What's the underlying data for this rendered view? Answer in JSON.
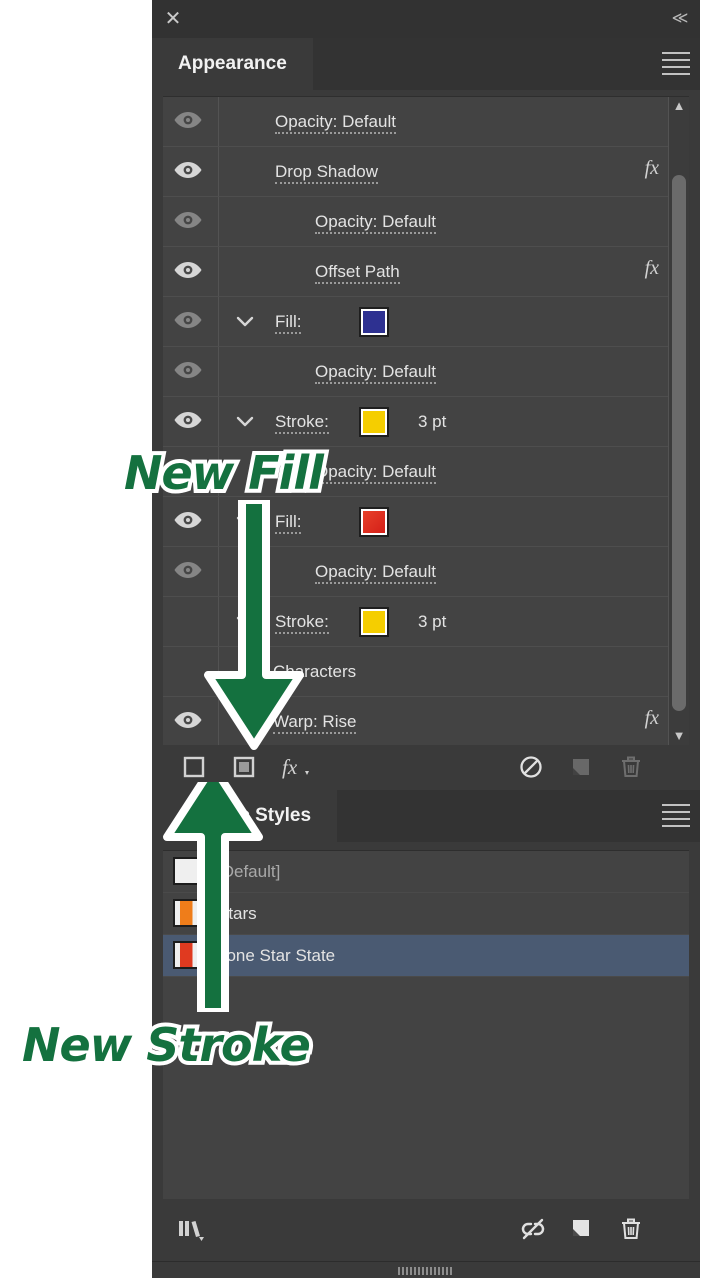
{
  "window": {
    "close_icon": "close-icon",
    "collapse_icon": "collapse-panel-icon"
  },
  "appearance_panel": {
    "tab_label": "Appearance",
    "menu_icon": "panel-menu-icon",
    "rows": [
      {
        "label": "Warp: Rise",
        "eye": "on",
        "twisty": false,
        "indent": 110,
        "fx": true,
        "swatch": null,
        "value": null,
        "type": "effect"
      },
      {
        "label": "Characters",
        "eye": "none",
        "twisty": false,
        "indent": 110,
        "fx": false,
        "swatch": null,
        "value": null,
        "type": "group"
      },
      {
        "label": "Stroke:",
        "eye": "none",
        "twisty": true,
        "indent": 112,
        "fx": false,
        "swatch": "#F5CE00",
        "value": "3 pt",
        "type": "stroke"
      },
      {
        "label": "Opacity: Default",
        "eye": "dim",
        "twisty": false,
        "indent": 152,
        "fx": false,
        "swatch": null,
        "value": null,
        "type": "opacity"
      },
      {
        "label": "Fill:",
        "eye": "on",
        "twisty": true,
        "indent": 112,
        "fx": false,
        "swatch": "#DA2B1E",
        "value": null,
        "type": "fill"
      },
      {
        "label": "Opacity: Default",
        "eye": "dim",
        "twisty": false,
        "indent": 152,
        "fx": false,
        "swatch": null,
        "value": null,
        "type": "opacity"
      },
      {
        "label": "Stroke:",
        "eye": "on",
        "twisty": true,
        "indent": 112,
        "fx": false,
        "swatch": "#F5CE00",
        "value": "3 pt",
        "type": "stroke"
      },
      {
        "label": "Opacity: Default",
        "eye": "dim",
        "twisty": false,
        "indent": 152,
        "fx": false,
        "swatch": null,
        "value": null,
        "type": "opacity"
      },
      {
        "label": "Fill:",
        "eye": "dim",
        "twisty": true,
        "indent": 112,
        "fx": false,
        "swatch": "#2E3191",
        "value": null,
        "type": "fill"
      },
      {
        "label": "Offset Path",
        "eye": "on",
        "twisty": false,
        "indent": 152,
        "fx": true,
        "swatch": null,
        "value": null,
        "type": "effect"
      },
      {
        "label": "Opacity: Default",
        "eye": "dim",
        "twisty": false,
        "indent": 152,
        "fx": false,
        "swatch": null,
        "value": null,
        "type": "opacity"
      },
      {
        "label": "Drop Shadow",
        "eye": "on",
        "twisty": false,
        "indent": 112,
        "fx": true,
        "swatch": null,
        "value": null,
        "type": "effect"
      },
      {
        "label": "Opacity: Default",
        "eye": "dim",
        "twisty": false,
        "indent": 112,
        "fx": false,
        "swatch": null,
        "value": null,
        "type": "opacity"
      }
    ],
    "scrollbar": {
      "up_icon": "chevron-up-icon",
      "down_icon": "chevron-down-icon"
    },
    "toolbar": [
      {
        "name": "add-new-stroke-button",
        "icon": "new-stroke-icon",
        "enabled": true
      },
      {
        "name": "add-new-fill-button",
        "icon": "new-fill-icon",
        "enabled": true
      },
      {
        "name": "add-new-effect-button",
        "icon": "fx-icon",
        "enabled": true
      },
      {
        "name": "clear-appearance-button",
        "icon": "clear-appearance-icon",
        "enabled": true
      },
      {
        "name": "duplicate-item-button",
        "icon": "duplicate-icon",
        "enabled": false
      },
      {
        "name": "delete-item-button",
        "icon": "trash-icon",
        "enabled": false
      }
    ]
  },
  "styles_panel": {
    "tab_label": "Graphic Styles",
    "menu_icon": "panel-menu-icon",
    "items": [
      {
        "label": "[Default]",
        "selected": false,
        "thumb": "#efefef",
        "muted": true
      },
      {
        "label": "Stars",
        "selected": false,
        "thumb": "#ef7d1a",
        "muted": false
      },
      {
        "label": "Lone Star State",
        "selected": true,
        "thumb": "#e03a20",
        "muted": false
      }
    ],
    "toolbar": [
      {
        "name": "styles-libraries-button",
        "icon": "library-icon",
        "enabled": true
      },
      {
        "name": "break-link-to-style-button",
        "icon": "break-link-icon",
        "enabled": true
      },
      {
        "name": "new-style-button",
        "icon": "new-document-icon",
        "enabled": true
      },
      {
        "name": "delete-style-button",
        "icon": "trash-icon",
        "enabled": true
      }
    ],
    "resize_grip": "resize-grip"
  },
  "annotations": [
    {
      "name": "new-fill-annotation",
      "text": "New Fill",
      "color": "#14713f"
    },
    {
      "name": "new-stroke-annotation",
      "text": "New Stroke",
      "color": "#14713f"
    }
  ],
  "colors": {
    "panel_bg": "#3a3a3a",
    "list_bg": "#434343",
    "selection": "#4a5a72",
    "annotation_green": "#14713f"
  }
}
